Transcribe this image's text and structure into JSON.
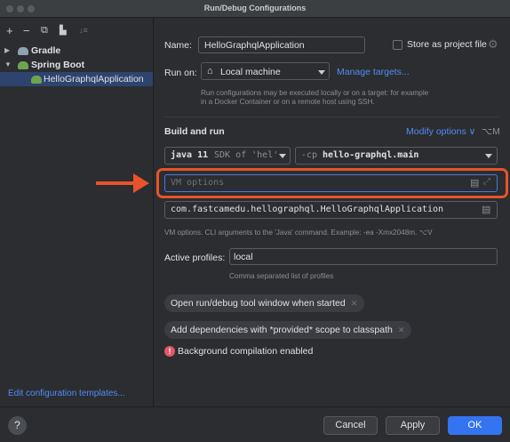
{
  "window": {
    "title": "Run/Debug Configurations"
  },
  "sidebar": {
    "toolbar": {
      "add": "+",
      "remove": "−",
      "copy": "⧉",
      "folder": "▙",
      "sort": "↓≡"
    },
    "tree": [
      {
        "label": "Gradle",
        "expanded": false,
        "icon": "gradle-elephant-icon"
      },
      {
        "label": "Spring Boot",
        "expanded": true,
        "icon": "spring-boot-icon"
      },
      {
        "label": "HelloGraphqlApplication",
        "selected": true,
        "icon": "spring-boot-run-icon"
      }
    ],
    "edit_templates": "Edit configuration templates..."
  },
  "config": {
    "name_label": "Name:",
    "name_value": "HelloGraphqlApplication",
    "store_as_project_file": "Store as project file",
    "run_on_label": "Run on:",
    "run_on_value": "Local machine",
    "manage_targets": "Manage targets...",
    "run_on_hint_1": "Run configurations may be executed locally or on a target: for example",
    "run_on_hint_2": "in a Docker Container or on a remote host using SSH.",
    "build_and_run": "Build and run",
    "modify_options": "Modify options ∨",
    "modify_options_shortcut": "⌥M",
    "jdk_value": "java 11",
    "jdk_suffix": "SDK of 'hel'",
    "classpath_prefix": "-cp",
    "classpath_value": "hello-graphql.main",
    "vm_options_placeholder": "VM options",
    "main_class": "com.fastcamedu.hellographql.HelloGraphqlApplication",
    "vm_hint": "VM options. CLI arguments to the 'Java' command. Example: -ea -Xmx2048m. ⌥V",
    "active_profiles_label": "Active profiles:",
    "active_profiles_value": "local",
    "active_profiles_hint": "Comma separated list of profiles",
    "chips": [
      "Open run/debug tool window when started",
      "Add dependencies with *provided* scope to classpath"
    ],
    "warning": "Background compilation enabled"
  },
  "footer": {
    "help": "?",
    "cancel": "Cancel",
    "apply": "Apply",
    "ok": "OK"
  },
  "colors": {
    "accent": "#3574f0",
    "link": "#548af7",
    "highlight": "#e8532a",
    "error": "#e55765",
    "selection": "#2e436e"
  }
}
